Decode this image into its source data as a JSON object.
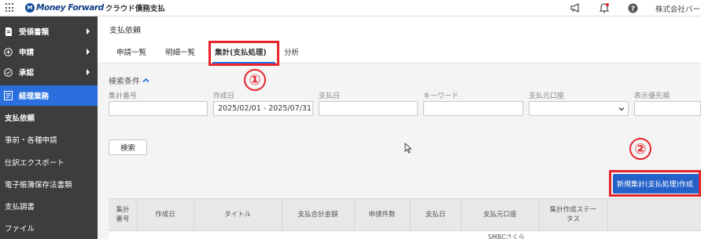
{
  "header": {
    "brand": "Money Forward",
    "app_name": "クラウド債務支払",
    "company": "株式会社バー",
    "icons": [
      "apps-grid-icon",
      "megaphone-icon",
      "bell-icon",
      "help-icon"
    ]
  },
  "sidebar": {
    "items": [
      {
        "label": "受領書類",
        "icon": "document-icon",
        "chevron": true
      },
      {
        "label": "申請",
        "icon": "plus-circle-icon",
        "chevron": true
      },
      {
        "label": "承認",
        "icon": "check-circle-icon",
        "chevron": true
      },
      {
        "label": "経理業務",
        "icon": "ledger-icon",
        "chevron": false
      }
    ],
    "subitems": [
      "支払依頼",
      "事前・各種申請",
      "仕訳エクスポート",
      "電子帳簿保存法書類",
      "支払調書",
      "ファイル"
    ]
  },
  "page": {
    "title": "支払依頼",
    "tabs": [
      "申請一覧",
      "明細一覧",
      "集計(支払処理)",
      "分析"
    ],
    "active_tab": "集計(支払処理)"
  },
  "search": {
    "title": "検索条件",
    "fields": [
      {
        "label": "集計番号",
        "value": ""
      },
      {
        "label": "作成日",
        "value": "2025/02/01 - 2025/07/31"
      },
      {
        "label": "支払日",
        "value": ""
      },
      {
        "label": "キーワード",
        "value": ""
      },
      {
        "label": "支払元口座",
        "value": ""
      },
      {
        "label": "表示優先順",
        "value": ""
      }
    ],
    "search_button": "検索"
  },
  "actions": {
    "new_summary_button": "新規集計(支払処理)作成"
  },
  "annotations": {
    "marker1": "①",
    "marker2": "②",
    "color": "#e6242b"
  },
  "table": {
    "columns": [
      "集計番号",
      "作成日",
      "タイトル",
      "支払合計金額",
      "申請件数",
      "支払日",
      "支払元口座",
      "集計作成ステータス",
      ""
    ],
    "partial_row_text": "SMBCさくら"
  },
  "colors": {
    "sidebar_bg": "#3d3d3f",
    "accent": "#2b6fde",
    "primary_button": "#2461c9"
  }
}
